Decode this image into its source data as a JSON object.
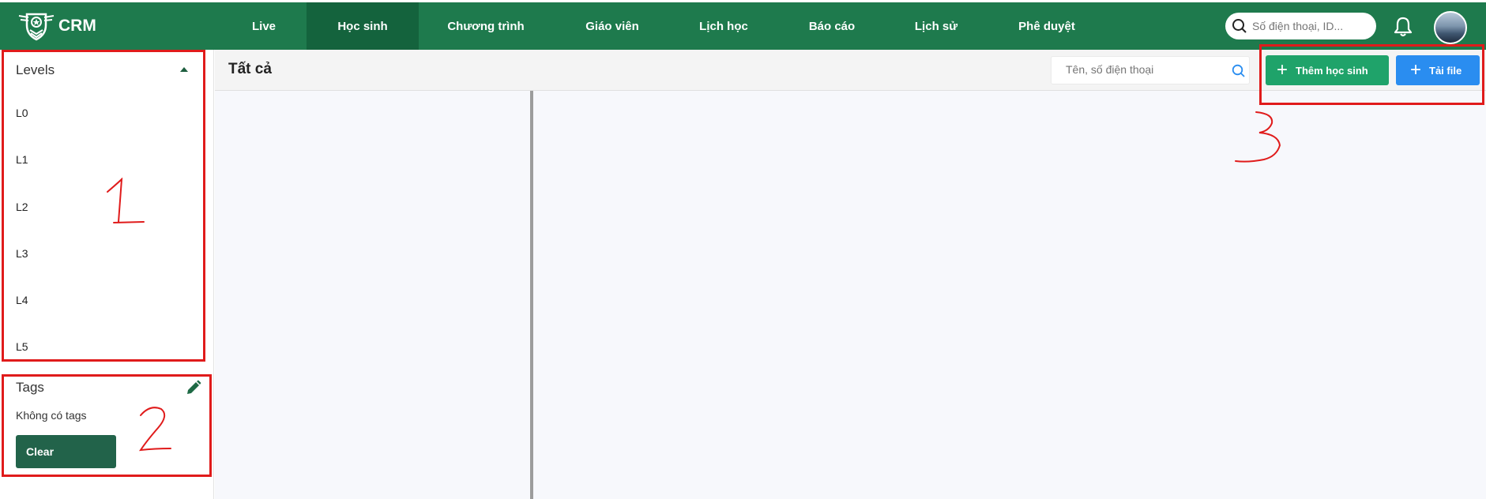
{
  "app": {
    "logo_text": "CRM",
    "brand_color": "#1e7a4d",
    "active_tab_color": "#14633d"
  },
  "nav": {
    "items": [
      {
        "label": "Live"
      },
      {
        "label": "Học sinh",
        "active": true
      },
      {
        "label": "Chương trình"
      },
      {
        "label": "Giáo viên"
      },
      {
        "label": "Lịch học"
      },
      {
        "label": "Báo cáo"
      },
      {
        "label": "Lịch sử"
      },
      {
        "label": "Phê duyệt"
      }
    ],
    "search_placeholder": "Số điện thoại, ID...",
    "icons": [
      "search-icon",
      "bell-icon",
      "avatar"
    ]
  },
  "sidebar": {
    "levels_title": "Levels",
    "levels": [
      "L0",
      "L1",
      "L2",
      "L3",
      "L4",
      "L5"
    ],
    "tags_title": "Tags",
    "no_tags_text": "Không có tags",
    "clear_label": "Clear"
  },
  "main": {
    "title": "Tất cả",
    "search_placeholder": "Tên, số điện thoại",
    "add_student_label": "Thêm học sinh",
    "upload_label": "Tải file",
    "add_color": "#1fa36a",
    "upload_color": "#2a8df0"
  },
  "annotations": {
    "color": "#e01b1b",
    "labels": [
      "1",
      "2",
      "3"
    ]
  }
}
